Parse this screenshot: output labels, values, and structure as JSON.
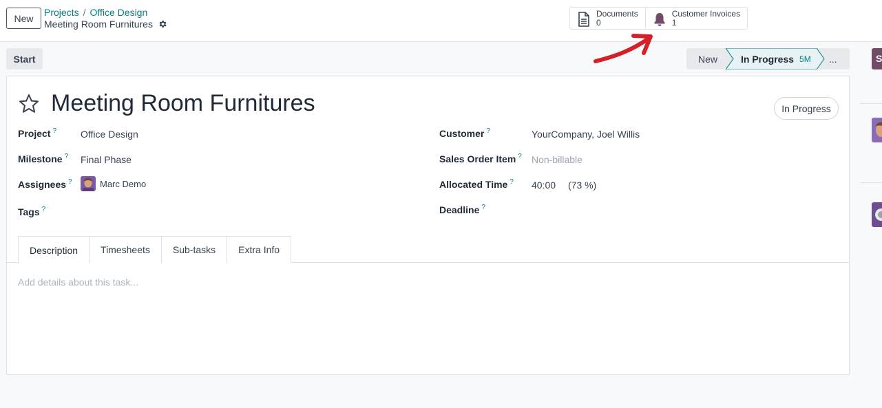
{
  "control_panel": {
    "new_button": "New",
    "breadcrumb": [
      "Projects",
      "Office Design"
    ],
    "breadcrumb_separator": "/",
    "record_title": "Meeting Room Furnitures"
  },
  "smart_buttons": [
    {
      "label": "Documents",
      "value": "0",
      "icon": "document-icon"
    },
    {
      "label": "Customer Invoices",
      "value": "1",
      "icon": "bell-icon"
    }
  ],
  "status_bar": {
    "start_button": "Start",
    "stages": {
      "new": "New",
      "current": "In Progress",
      "current_duration": "5M",
      "more": "..."
    }
  },
  "form": {
    "title": "Meeting Room Furnitures",
    "state": "In Progress",
    "help_mark": "?",
    "left_fields": {
      "project": {
        "label": "Project",
        "value": "Office Design"
      },
      "milestone": {
        "label": "Milestone",
        "value": "Final Phase"
      },
      "assignees": {
        "label": "Assignees",
        "value": "Marc Demo"
      },
      "tags": {
        "label": "Tags",
        "value": ""
      }
    },
    "right_fields": {
      "customer": {
        "label": "Customer",
        "value": "YourCompany, Joel Willis"
      },
      "sales_order_item": {
        "label": "Sales Order Item",
        "value": "Non-billable"
      },
      "allocated_time": {
        "label": "Allocated Time",
        "value": "40:00",
        "percent": "(73 %)"
      },
      "deadline": {
        "label": "Deadline",
        "value": ""
      }
    },
    "tabs": [
      "Description",
      "Timesheets",
      "Sub-tasks",
      "Extra Info"
    ],
    "active_tab": "Description",
    "description_placeholder": "Add details about this task..."
  },
  "chatter": {
    "button_initial": "S"
  },
  "colors": {
    "brand_teal": "#017e84",
    "brand_purple": "#714b67",
    "annotation_arrow": "#d62027"
  }
}
